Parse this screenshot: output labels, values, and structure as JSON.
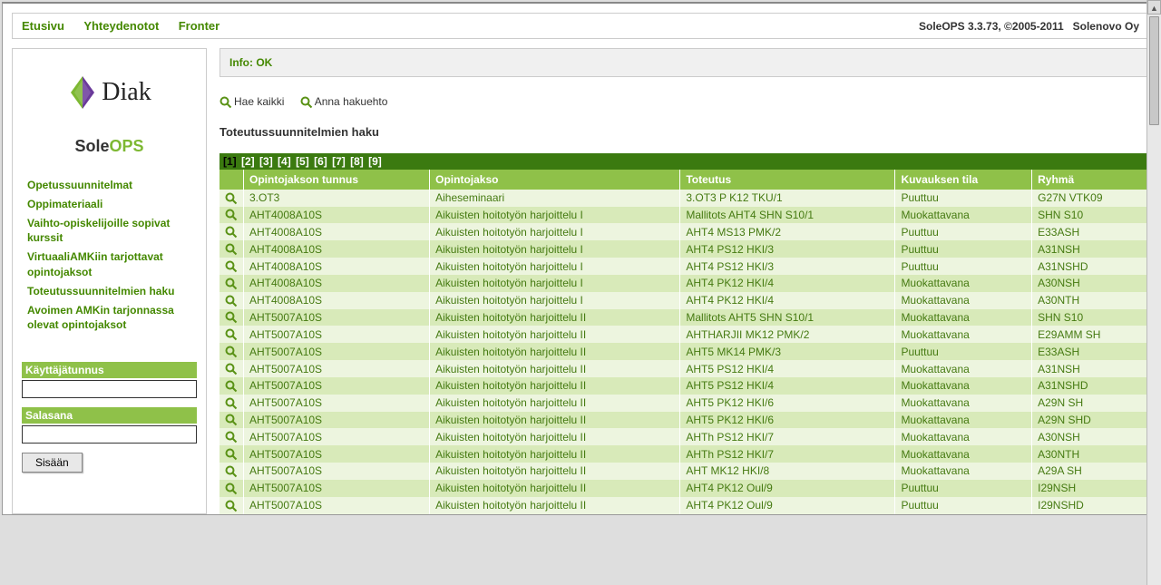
{
  "topnav": {
    "home": "Etusivu",
    "contacts": "Yhteydenotot",
    "fronter": "Fronter"
  },
  "topright": {
    "app": "SoleOPS 3.3.73",
    "copyright": ", ©2005-2011",
    "vendor": "Solenovo Oy"
  },
  "app_title": {
    "prefix": "Sole",
    "suffix": "OPS"
  },
  "logo_text": "Diak",
  "sidebar_links": [
    "Opetussuunnitelmat",
    "Oppimateriaali",
    "Vaihto-opiskelijoille sopivat kurssit",
    "VirtuaaliAMKiin tarjottavat opintojaksot",
    "Toteutussuunnitelmien haku",
    "Avoimen AMKin tarjonnassa olevat opintojaksot"
  ],
  "login": {
    "user_label": "Käyttäjätunnus",
    "pass_label": "Salasana",
    "submit": "Sisään"
  },
  "info_bar": "Info: OK",
  "search_links": {
    "all": "Hae kaikki",
    "criteria": "Anna hakuehto"
  },
  "page_heading": "Toteutussuunnitelmien haku",
  "pagination": [
    "1",
    "2",
    "3",
    "4",
    "5",
    "6",
    "7",
    "8",
    "9"
  ],
  "current_page": "1",
  "columns": {
    "code": "Opintojakson tunnus",
    "course": "Opintojakso",
    "impl": "Toteutus",
    "state": "Kuvauksen tila",
    "group": "Ryhmä"
  },
  "rows": [
    {
      "code": "3.OT3",
      "course": "Aiheseminaari",
      "impl": "3.OT3 P K12 TKU/1",
      "state": "Puuttuu",
      "group": "G27N VTK09"
    },
    {
      "code": "AHT4008A10S",
      "course": "Aikuisten hoitotyön harjoittelu I",
      "impl": "Mallitots AHT4 SHN S10/1",
      "state": "Muokattavana",
      "group": "SHN S10"
    },
    {
      "code": "AHT4008A10S",
      "course": "Aikuisten hoitotyön harjoittelu I",
      "impl": "AHT4 MS13 PMK/2",
      "state": "Puuttuu",
      "group": "E33ASH"
    },
    {
      "code": "AHT4008A10S",
      "course": "Aikuisten hoitotyön harjoittelu I",
      "impl": "AHT4 PS12 HKI/3",
      "state": "Puuttuu",
      "group": "A31NSH"
    },
    {
      "code": "AHT4008A10S",
      "course": "Aikuisten hoitotyön harjoittelu I",
      "impl": "AHT4 PS12 HKI/3",
      "state": "Puuttuu",
      "group": "A31NSHD"
    },
    {
      "code": "AHT4008A10S",
      "course": "Aikuisten hoitotyön harjoittelu I",
      "impl": "AHT4 PK12 HKI/4",
      "state": "Muokattavana",
      "group": "A30NSH"
    },
    {
      "code": "AHT4008A10S",
      "course": "Aikuisten hoitotyön harjoittelu I",
      "impl": "AHT4 PK12 HKI/4",
      "state": "Muokattavana",
      "group": "A30NTH"
    },
    {
      "code": "AHT5007A10S",
      "course": "Aikuisten hoitotyön harjoittelu II",
      "impl": "Mallitots AHT5 SHN S10/1",
      "state": "Muokattavana",
      "group": "SHN S10"
    },
    {
      "code": "AHT5007A10S",
      "course": "Aikuisten hoitotyön harjoittelu II",
      "impl": "AHTHARJII MK12 PMK/2",
      "state": "Muokattavana",
      "group": "E29AMM SH"
    },
    {
      "code": "AHT5007A10S",
      "course": "Aikuisten hoitotyön harjoittelu II",
      "impl": "AHT5 MK14 PMK/3",
      "state": "Puuttuu",
      "group": "E33ASH"
    },
    {
      "code": "AHT5007A10S",
      "course": "Aikuisten hoitotyön harjoittelu II",
      "impl": "AHT5 PS12 HKI/4",
      "state": "Muokattavana",
      "group": "A31NSH"
    },
    {
      "code": "AHT5007A10S",
      "course": "Aikuisten hoitotyön harjoittelu II",
      "impl": "AHT5 PS12 HKI/4",
      "state": "Muokattavana",
      "group": "A31NSHD"
    },
    {
      "code": "AHT5007A10S",
      "course": "Aikuisten hoitotyön harjoittelu II",
      "impl": "AHT5 PK12 HKI/6",
      "state": "Muokattavana",
      "group": "A29N SH"
    },
    {
      "code": "AHT5007A10S",
      "course": "Aikuisten hoitotyön harjoittelu II",
      "impl": "AHT5 PK12 HKI/6",
      "state": "Muokattavana",
      "group": "A29N SHD"
    },
    {
      "code": "AHT5007A10S",
      "course": "Aikuisten hoitotyön harjoittelu II",
      "impl": "AHTh PS12 HKI/7",
      "state": "Muokattavana",
      "group": "A30NSH"
    },
    {
      "code": "AHT5007A10S",
      "course": "Aikuisten hoitotyön harjoittelu II",
      "impl": "AHTh PS12 HKI/7",
      "state": "Muokattavana",
      "group": "A30NTH"
    },
    {
      "code": "AHT5007A10S",
      "course": "Aikuisten hoitotyön harjoittelu II",
      "impl": "AHT MK12 HKI/8",
      "state": "Muokattavana",
      "group": "A29A SH"
    },
    {
      "code": "AHT5007A10S",
      "course": "Aikuisten hoitotyön harjoittelu II",
      "impl": "AHT4 PK12 Oul/9",
      "state": "Puuttuu",
      "group": "I29NSH"
    },
    {
      "code": "AHT5007A10S",
      "course": "Aikuisten hoitotyön harjoittelu II",
      "impl": "AHT4 PK12 Oul/9",
      "state": "Puuttuu",
      "group": "I29NSHD"
    }
  ]
}
